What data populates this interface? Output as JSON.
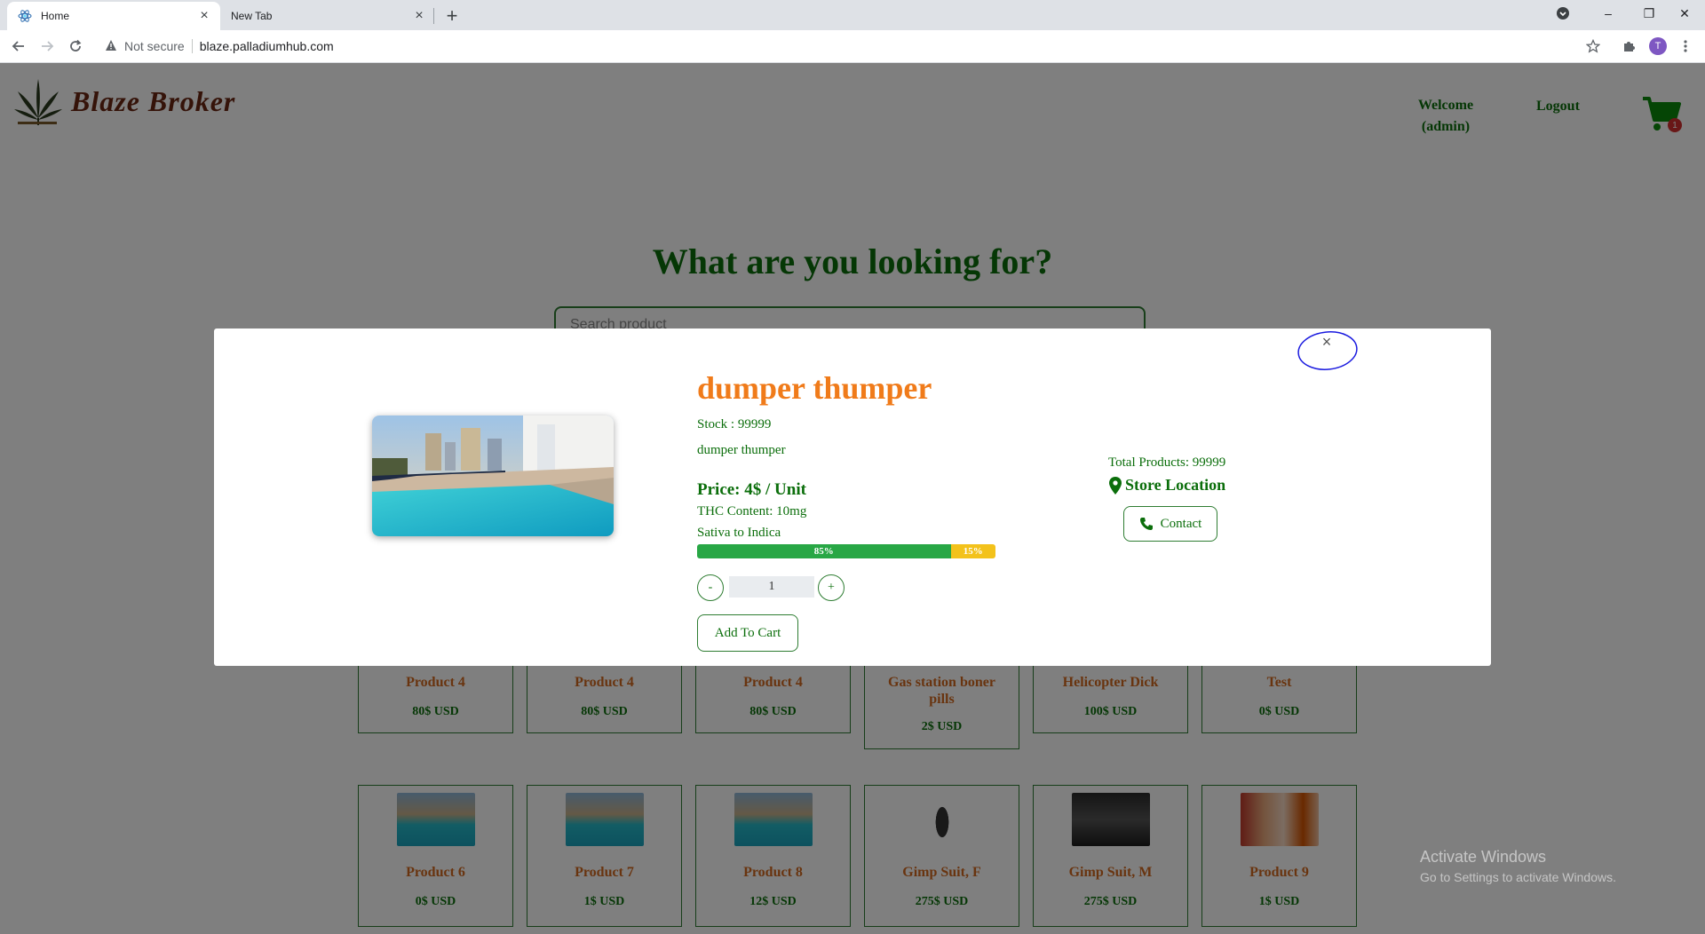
{
  "browser": {
    "tabs": [
      {
        "label": "Home",
        "close": "×"
      },
      {
        "label": "New Tab",
        "close": "×"
      }
    ],
    "new_tab": "+",
    "security": "Not secure",
    "url": "blaze.palladiumhub.com",
    "profile_initial": "T",
    "window_controls": {
      "minimize": "–",
      "restore": "❐",
      "close": "✕"
    }
  },
  "header": {
    "logo_text": "Blaze Broker",
    "welcome_line1": "Welcome",
    "welcome_line2": "(admin)",
    "logout": "Logout",
    "cart_count": "1"
  },
  "hero": {
    "headline": "What are you looking for?",
    "search_placeholder": "Search product"
  },
  "products_row1": [
    {
      "name": "Product 4",
      "price": "80$ USD"
    },
    {
      "name": "Product 4",
      "price": "80$ USD"
    },
    {
      "name": "Product 4",
      "price": "80$ USD"
    },
    {
      "name": "Gas station boner pills",
      "price": "2$ USD"
    },
    {
      "name": "Helicopter Dick",
      "price": "100$ USD"
    },
    {
      "name": "Test",
      "price": "0$ USD"
    }
  ],
  "products_row2": [
    {
      "name": "Product 6",
      "price": "0$ USD",
      "image": "pool"
    },
    {
      "name": "Product 7",
      "price": "1$ USD",
      "image": "pool"
    },
    {
      "name": "Product 8",
      "price": "12$ USD",
      "image": "pool"
    },
    {
      "name": "Gimp Suit, F",
      "price": "275$ USD",
      "image": "figure"
    },
    {
      "name": "Gimp Suit, M",
      "price": "275$ USD",
      "image": "dark"
    },
    {
      "name": "Product 9",
      "price": "1$ USD",
      "image": "drinks"
    }
  ],
  "modal": {
    "close": "×",
    "title": "dumper thumper",
    "stock": "Stock : 99999",
    "description": "dumper thumper",
    "price": "Price: 4$ / Unit",
    "thc": "THC Content: 10mg",
    "strain_label": "Sativa to Indica",
    "sativa_percent": 85,
    "indica_percent": 15,
    "sativa_label": "85%",
    "indica_label": "15%",
    "qty_minus": "-",
    "qty_plus": "+",
    "quantity": "1",
    "add_to_cart": "Add To Cart",
    "total_products": "Total Products: 99999",
    "store_location": "Store Location",
    "contact": "Contact"
  },
  "watermark": {
    "line1": "Activate Windows",
    "line2": "Go to Settings to activate Windows."
  },
  "colors": {
    "brand_green": "#0b6e0b",
    "title_orange": "#f07b1a",
    "sativa_green": "#28a745",
    "indica_yellow": "#f3c21b",
    "annotation_blue": "#1a1adf"
  }
}
